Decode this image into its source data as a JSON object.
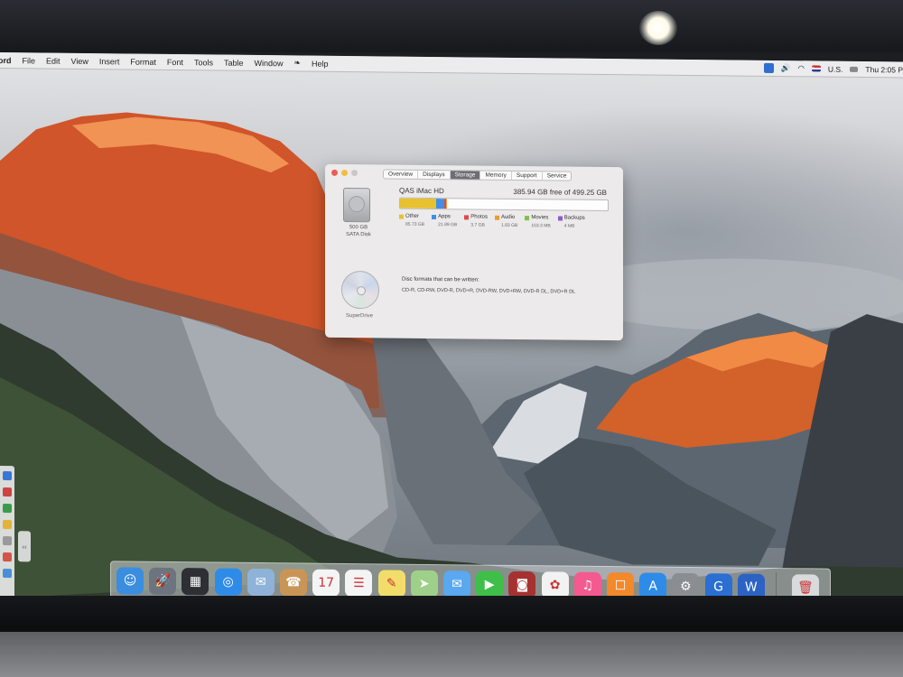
{
  "menubar": {
    "app_name": "ord",
    "items": [
      "File",
      "Edit",
      "View",
      "Insert",
      "Format",
      "Font",
      "Tools",
      "Table",
      "Window",
      "Help"
    ],
    "input_source": "U.S.",
    "clock": "Thu 2:05 P"
  },
  "window": {
    "tabs": [
      "Overview",
      "Displays",
      "Storage",
      "Memory",
      "Support",
      "Service"
    ],
    "active_tab": "Storage",
    "drive": {
      "name": "QAS iMac HD",
      "free_text": "385.94 GB free of 499.25 GB",
      "capacity": "500 GB",
      "type": "SATA Disk",
      "usage": [
        {
          "label": "Other",
          "value": "85.73 GB",
          "color": "#e8c12f"
        },
        {
          "label": "Apps",
          "value": "21.89 GB",
          "color": "#3f8fe6"
        },
        {
          "label": "Photos",
          "value": "3.7 GB",
          "color": "#e2474f"
        },
        {
          "label": "Audio",
          "value": "1.83 GB",
          "color": "#f09a30"
        },
        {
          "label": "Movies",
          "value": "153.3 MB",
          "color": "#7cc24a"
        },
        {
          "label": "Backups",
          "value": "4 MB",
          "color": "#8b5ec9"
        }
      ]
    },
    "optical": {
      "name": "SuperDrive",
      "formats_title": "Disc formats that can be written:",
      "formats": "CD-R, CD-RW, DVD-R, DVD+R, DVD-RW, DVD+RW, DVD-R DL, DVD+R DL"
    }
  },
  "dock": {
    "apps": [
      {
        "name": "finder",
        "color": "#3b8de0",
        "glyph": "☺"
      },
      {
        "name": "launchpad",
        "color": "#6d7480",
        "glyph": "🚀"
      },
      {
        "name": "mission-control",
        "color": "#2d2f35",
        "glyph": "▦"
      },
      {
        "name": "safari",
        "color": "#2f8be8",
        "glyph": "◎"
      },
      {
        "name": "preview",
        "color": "#8fb3d8",
        "glyph": "✉"
      },
      {
        "name": "contacts",
        "color": "#c99557",
        "glyph": "☎"
      },
      {
        "name": "calendar",
        "color": "#f4f4f4",
        "glyph": "17"
      },
      {
        "name": "reminders",
        "color": "#f4f4f4",
        "glyph": "☰"
      },
      {
        "name": "notes",
        "color": "#f3dd6a",
        "glyph": "✎"
      },
      {
        "name": "maps",
        "color": "#9fd08a",
        "glyph": "➤"
      },
      {
        "name": "messages",
        "color": "#5aa8f0",
        "glyph": "✉"
      },
      {
        "name": "facetime",
        "color": "#3fbf4a",
        "glyph": "▶"
      },
      {
        "name": "photo-booth",
        "color": "#a53131",
        "glyph": "◙"
      },
      {
        "name": "photos",
        "color": "#f2f2f2",
        "glyph": "✿"
      },
      {
        "name": "itunes",
        "color": "#f45a8f",
        "glyph": "♫"
      },
      {
        "name": "ibooks",
        "color": "#f2892b",
        "glyph": "☐"
      },
      {
        "name": "app-store",
        "color": "#2f8be8",
        "glyph": "A"
      },
      {
        "name": "system-preferences",
        "color": "#8a8d92",
        "glyph": "⚙"
      },
      {
        "name": "teamviewer",
        "color": "#2a6fd1",
        "glyph": "G"
      },
      {
        "name": "word",
        "color": "#2b62c4",
        "glyph": "W"
      },
      {
        "name": "trash",
        "color": "#d8dadc",
        "glyph": "🗑"
      }
    ]
  }
}
